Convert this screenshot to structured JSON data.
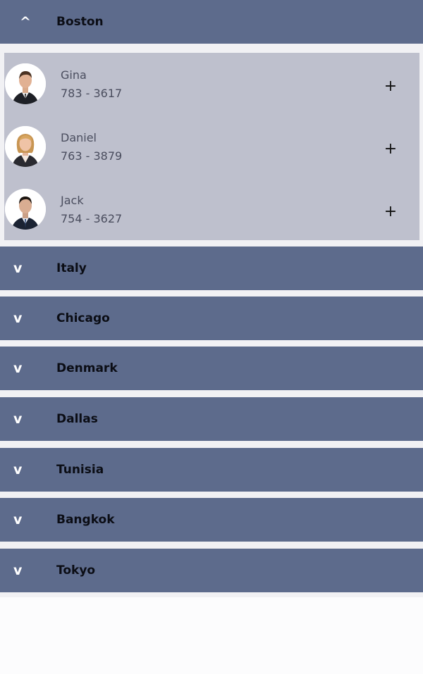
{
  "colors": {
    "header_bg": "#5d6b8c",
    "panel_bg": "#bec0cd",
    "page_bg": "#f1f1f4"
  },
  "expanded_group": {
    "toggle_icon": "^",
    "title": "Boston",
    "contacts": [
      {
        "name": "Gina",
        "phone": "783 - 3617",
        "action": "+",
        "avatar": "man-suit-avatar"
      },
      {
        "name": "Daniel",
        "phone": "763 - 3879",
        "action": "+",
        "avatar": "woman-blazer-avatar"
      },
      {
        "name": "Jack",
        "phone": "754 - 3627",
        "action": "+",
        "avatar": "man-tie-avatar"
      }
    ]
  },
  "collapsed_groups": [
    {
      "toggle_icon": "v",
      "title": "Italy"
    },
    {
      "toggle_icon": "v",
      "title": "Chicago"
    },
    {
      "toggle_icon": "v",
      "title": "Denmark"
    },
    {
      "toggle_icon": "v",
      "title": "Dallas"
    },
    {
      "toggle_icon": "v",
      "title": "Tunisia"
    },
    {
      "toggle_icon": "v",
      "title": "Bangkok"
    },
    {
      "toggle_icon": "v",
      "title": "Tokyo"
    }
  ]
}
